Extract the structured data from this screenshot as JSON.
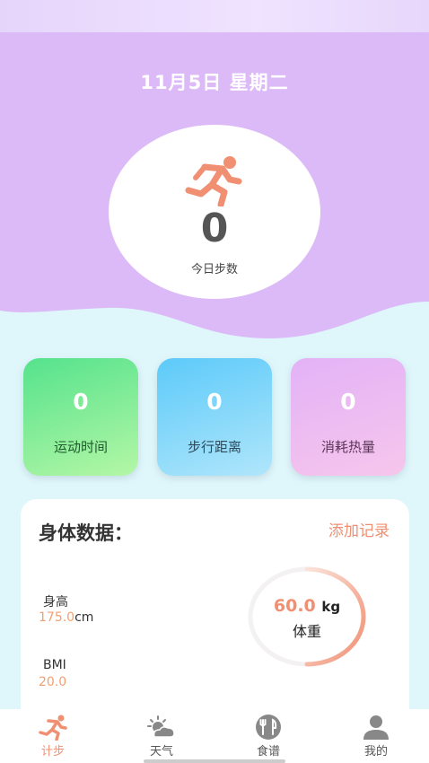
{
  "header": {
    "date": "11月5日 星期二",
    "steps": "0",
    "steps_label": "今日步数",
    "run_icon": "running-person-icon"
  },
  "stats": [
    {
      "value": "0",
      "label": "运动时间"
    },
    {
      "value": "0",
      "label": "步行距离"
    },
    {
      "value": "0",
      "label": "消耗热量"
    }
  ],
  "body_data": {
    "title": "身体数据：",
    "add_label": "添加记录",
    "height": {
      "label": "身高",
      "value": "175.0",
      "unit": "cm"
    },
    "bmi": {
      "label": "BMI",
      "value": "20.0"
    },
    "weight": {
      "value": "60.0",
      "unit": "kg",
      "label": "体重"
    }
  },
  "tabs": [
    {
      "label": "计步",
      "icon": "running-person-icon",
      "active": true
    },
    {
      "label": "天气",
      "icon": "weather-icon",
      "active": false
    },
    {
      "label": "食谱",
      "icon": "recipe-icon",
      "active": false
    },
    {
      "label": "我的",
      "icon": "profile-icon",
      "active": false
    }
  ],
  "colors": {
    "header_purple": "#dcbaf8",
    "background": "#dff7fb",
    "accent": "#f08f72"
  }
}
